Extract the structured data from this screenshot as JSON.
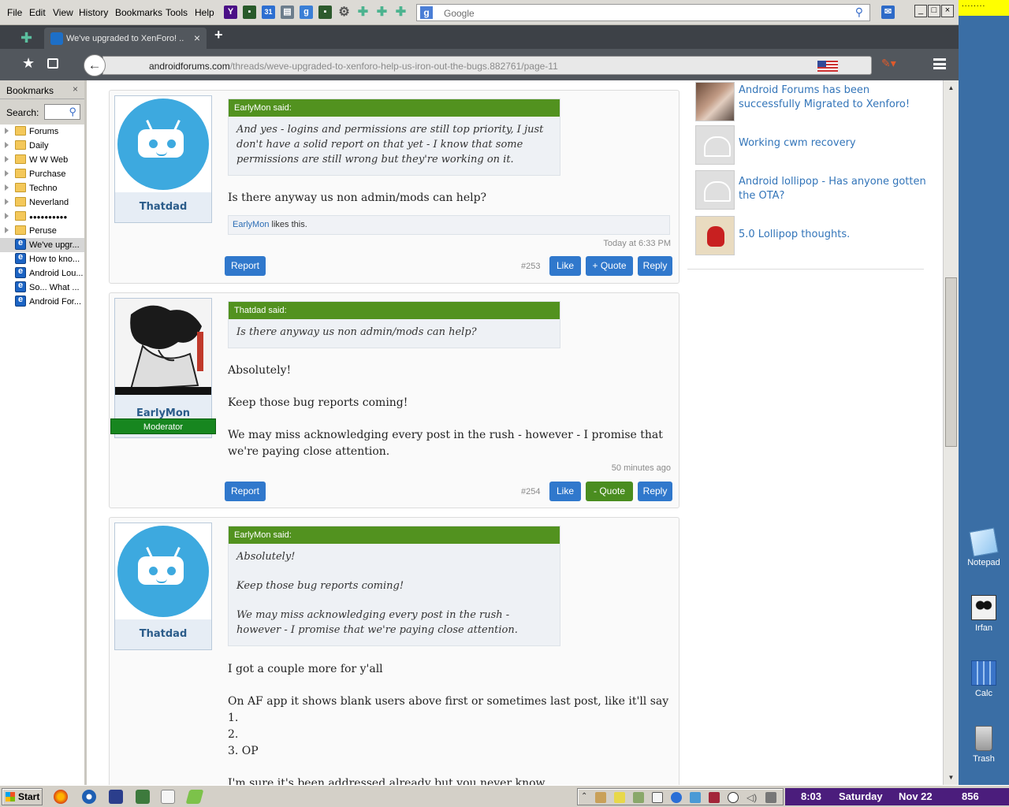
{
  "menu": {
    "file": "File",
    "edit": "Edit",
    "view": "View",
    "history": "History",
    "bookmarks": "Bookmarks",
    "tools": "Tools",
    "help": "Help"
  },
  "search": {
    "placeholder": "Google"
  },
  "tab": {
    "title": "We've upgraded to XenForo! ...",
    "close": "×",
    "new": "+"
  },
  "url": {
    "host": "androidforums.com",
    "path": "/threads/weve-upgraded-to-xenforo-help-us-iron-out-the-bugs.882761/page-11"
  },
  "sidebar": {
    "title": "Bookmarks",
    "close": "×",
    "search_label": "Search:",
    "folders": [
      "Forums",
      "Daily",
      "W W Web",
      "Purchase",
      "Techno",
      "Neverland",
      "●●●●●●●●●●",
      "Peruse"
    ],
    "links": [
      "We've upgr...",
      "How to kno...",
      "Android Lou...",
      "So... What ...",
      "Android For..."
    ]
  },
  "posts": [
    {
      "author": "Thatdad",
      "quote_author": "EarlyMon said:",
      "quote": [
        "And yes - logins and permissions are still top priority, I just don't have a solid report on that yet - I know that some permissions are still wrong but they're working on it."
      ],
      "body": [
        "Is there anyway us non admin/mods can help?"
      ],
      "likes_user": "EarlyMon",
      "likes_text": " likes this.",
      "time": "Today at 6:33 PM",
      "number": "#253",
      "report": "Report",
      "like": "Like",
      "quote_btn": "+ Quote",
      "reply": "Reply"
    },
    {
      "author": "EarlyMon",
      "role": "Moderator",
      "quote_author": "Thatdad said:",
      "quote": [
        "Is there anyway us non admin/mods can help?"
      ],
      "body": [
        "Absolutely!",
        "Keep those bug reports coming!",
        "We may miss acknowledging every post in the rush - however - I promise that we're paying close attention."
      ],
      "time": "50 minutes ago",
      "number": "#254",
      "report": "Report",
      "like": "Like",
      "quote_btn": "- Quote",
      "reply": "Reply"
    },
    {
      "author": "Thatdad",
      "quote_author": "EarlyMon said:",
      "quote": [
        "Absolutely!",
        "Keep those bug reports coming!",
        "We may miss acknowledging every post in the rush - however - I promise that we're paying close attention."
      ],
      "body": [
        "I got a couple more for y'all",
        "On AF app it shows blank users above first or sometimes last post, like it'll say 1.\n2.\n3. OP",
        "I'm sure it's been addressed already but you never know"
      ]
    }
  ],
  "related": [
    {
      "title": "Android Forums has been successfully Migrated to Xenforo!",
      "thumb": "photo"
    },
    {
      "title": "Working cwm recovery",
      "thumb": "droid"
    },
    {
      "title": "Android lollipop - Has anyone gotten the OTA?",
      "thumb": "droid"
    },
    {
      "title": "5.0 Lollipop thoughts.",
      "thumb": "spidey"
    }
  ],
  "desktop": {
    "notepad": "Notepad",
    "irfan": "Irfan",
    "calc": "Calc",
    "trash": "Trash",
    "ticker": "........"
  },
  "taskbar": {
    "start": "Start",
    "time": "8:03",
    "day": "Saturday",
    "date": "Nov 22",
    "count": "856"
  },
  "colors": {
    "accent_blue": "#3078cc",
    "quote_green": "#52921f",
    "mod_green": "#17861f",
    "link": "#3375b9",
    "clock_bg": "#4b1d7c"
  }
}
